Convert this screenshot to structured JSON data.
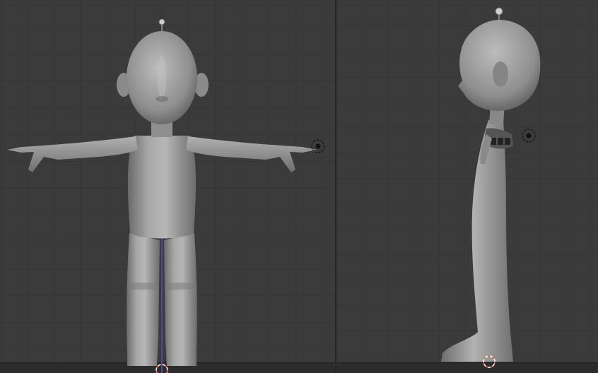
{
  "scene": {
    "views": [
      {
        "id": "front",
        "label": ""
      },
      {
        "id": "side",
        "label": ""
      }
    ],
    "colors": {
      "background": "#3b3b3b",
      "mesh_light": "#b4b4b4",
      "mesh_mid": "#8c8c8c",
      "mesh_dark": "#5a5a5a",
      "z_axis": "#4a4aa0",
      "cursor": "#e06030"
    },
    "icons": [
      "object-origin-icon",
      "light-empty-icon",
      "3d-cursor-icon"
    ]
  }
}
